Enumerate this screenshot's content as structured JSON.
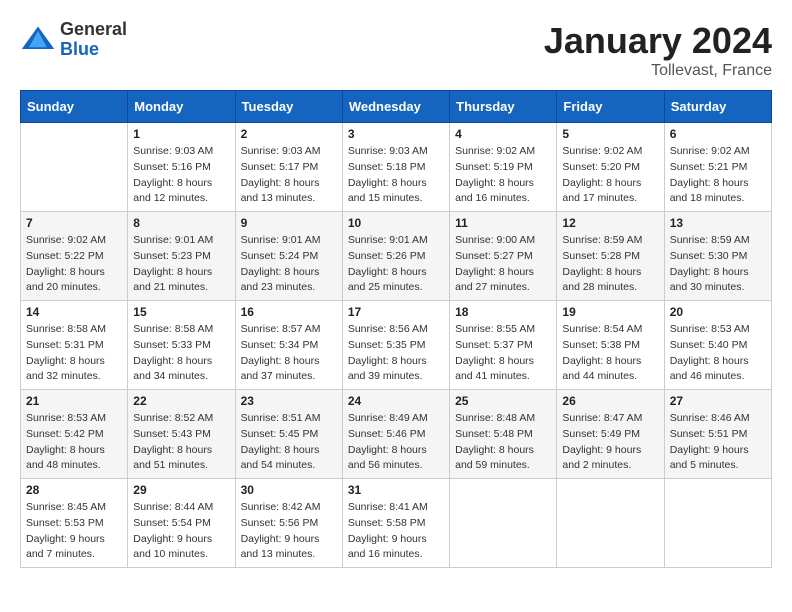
{
  "header": {
    "logo_general": "General",
    "logo_blue": "Blue",
    "month_title": "January 2024",
    "location": "Tollevast, France"
  },
  "columns": [
    "Sunday",
    "Monday",
    "Tuesday",
    "Wednesday",
    "Thursday",
    "Friday",
    "Saturday"
  ],
  "weeks": [
    [
      {
        "day": "",
        "sunrise": "",
        "sunset": "",
        "daylight": ""
      },
      {
        "day": "1",
        "sunrise": "Sunrise: 9:03 AM",
        "sunset": "Sunset: 5:16 PM",
        "daylight": "Daylight: 8 hours and 12 minutes."
      },
      {
        "day": "2",
        "sunrise": "Sunrise: 9:03 AM",
        "sunset": "Sunset: 5:17 PM",
        "daylight": "Daylight: 8 hours and 13 minutes."
      },
      {
        "day": "3",
        "sunrise": "Sunrise: 9:03 AM",
        "sunset": "Sunset: 5:18 PM",
        "daylight": "Daylight: 8 hours and 15 minutes."
      },
      {
        "day": "4",
        "sunrise": "Sunrise: 9:02 AM",
        "sunset": "Sunset: 5:19 PM",
        "daylight": "Daylight: 8 hours and 16 minutes."
      },
      {
        "day": "5",
        "sunrise": "Sunrise: 9:02 AM",
        "sunset": "Sunset: 5:20 PM",
        "daylight": "Daylight: 8 hours and 17 minutes."
      },
      {
        "day": "6",
        "sunrise": "Sunrise: 9:02 AM",
        "sunset": "Sunset: 5:21 PM",
        "daylight": "Daylight: 8 hours and 18 minutes."
      }
    ],
    [
      {
        "day": "7",
        "sunrise": "Sunrise: 9:02 AM",
        "sunset": "Sunset: 5:22 PM",
        "daylight": "Daylight: 8 hours and 20 minutes."
      },
      {
        "day": "8",
        "sunrise": "Sunrise: 9:01 AM",
        "sunset": "Sunset: 5:23 PM",
        "daylight": "Daylight: 8 hours and 21 minutes."
      },
      {
        "day": "9",
        "sunrise": "Sunrise: 9:01 AM",
        "sunset": "Sunset: 5:24 PM",
        "daylight": "Daylight: 8 hours and 23 minutes."
      },
      {
        "day": "10",
        "sunrise": "Sunrise: 9:01 AM",
        "sunset": "Sunset: 5:26 PM",
        "daylight": "Daylight: 8 hours and 25 minutes."
      },
      {
        "day": "11",
        "sunrise": "Sunrise: 9:00 AM",
        "sunset": "Sunset: 5:27 PM",
        "daylight": "Daylight: 8 hours and 27 minutes."
      },
      {
        "day": "12",
        "sunrise": "Sunrise: 8:59 AM",
        "sunset": "Sunset: 5:28 PM",
        "daylight": "Daylight: 8 hours and 28 minutes."
      },
      {
        "day": "13",
        "sunrise": "Sunrise: 8:59 AM",
        "sunset": "Sunset: 5:30 PM",
        "daylight": "Daylight: 8 hours and 30 minutes."
      }
    ],
    [
      {
        "day": "14",
        "sunrise": "Sunrise: 8:58 AM",
        "sunset": "Sunset: 5:31 PM",
        "daylight": "Daylight: 8 hours and 32 minutes."
      },
      {
        "day": "15",
        "sunrise": "Sunrise: 8:58 AM",
        "sunset": "Sunset: 5:33 PM",
        "daylight": "Daylight: 8 hours and 34 minutes."
      },
      {
        "day": "16",
        "sunrise": "Sunrise: 8:57 AM",
        "sunset": "Sunset: 5:34 PM",
        "daylight": "Daylight: 8 hours and 37 minutes."
      },
      {
        "day": "17",
        "sunrise": "Sunrise: 8:56 AM",
        "sunset": "Sunset: 5:35 PM",
        "daylight": "Daylight: 8 hours and 39 minutes."
      },
      {
        "day": "18",
        "sunrise": "Sunrise: 8:55 AM",
        "sunset": "Sunset: 5:37 PM",
        "daylight": "Daylight: 8 hours and 41 minutes."
      },
      {
        "day": "19",
        "sunrise": "Sunrise: 8:54 AM",
        "sunset": "Sunset: 5:38 PM",
        "daylight": "Daylight: 8 hours and 44 minutes."
      },
      {
        "day": "20",
        "sunrise": "Sunrise: 8:53 AM",
        "sunset": "Sunset: 5:40 PM",
        "daylight": "Daylight: 8 hours and 46 minutes."
      }
    ],
    [
      {
        "day": "21",
        "sunrise": "Sunrise: 8:53 AM",
        "sunset": "Sunset: 5:42 PM",
        "daylight": "Daylight: 8 hours and 48 minutes."
      },
      {
        "day": "22",
        "sunrise": "Sunrise: 8:52 AM",
        "sunset": "Sunset: 5:43 PM",
        "daylight": "Daylight: 8 hours and 51 minutes."
      },
      {
        "day": "23",
        "sunrise": "Sunrise: 8:51 AM",
        "sunset": "Sunset: 5:45 PM",
        "daylight": "Daylight: 8 hours and 54 minutes."
      },
      {
        "day": "24",
        "sunrise": "Sunrise: 8:49 AM",
        "sunset": "Sunset: 5:46 PM",
        "daylight": "Daylight: 8 hours and 56 minutes."
      },
      {
        "day": "25",
        "sunrise": "Sunrise: 8:48 AM",
        "sunset": "Sunset: 5:48 PM",
        "daylight": "Daylight: 8 hours and 59 minutes."
      },
      {
        "day": "26",
        "sunrise": "Sunrise: 8:47 AM",
        "sunset": "Sunset: 5:49 PM",
        "daylight": "Daylight: 9 hours and 2 minutes."
      },
      {
        "day": "27",
        "sunrise": "Sunrise: 8:46 AM",
        "sunset": "Sunset: 5:51 PM",
        "daylight": "Daylight: 9 hours and 5 minutes."
      }
    ],
    [
      {
        "day": "28",
        "sunrise": "Sunrise: 8:45 AM",
        "sunset": "Sunset: 5:53 PM",
        "daylight": "Daylight: 9 hours and 7 minutes."
      },
      {
        "day": "29",
        "sunrise": "Sunrise: 8:44 AM",
        "sunset": "Sunset: 5:54 PM",
        "daylight": "Daylight: 9 hours and 10 minutes."
      },
      {
        "day": "30",
        "sunrise": "Sunrise: 8:42 AM",
        "sunset": "Sunset: 5:56 PM",
        "daylight": "Daylight: 9 hours and 13 minutes."
      },
      {
        "day": "31",
        "sunrise": "Sunrise: 8:41 AM",
        "sunset": "Sunset: 5:58 PM",
        "daylight": "Daylight: 9 hours and 16 minutes."
      },
      {
        "day": "",
        "sunrise": "",
        "sunset": "",
        "daylight": ""
      },
      {
        "day": "",
        "sunrise": "",
        "sunset": "",
        "daylight": ""
      },
      {
        "day": "",
        "sunrise": "",
        "sunset": "",
        "daylight": ""
      }
    ]
  ]
}
